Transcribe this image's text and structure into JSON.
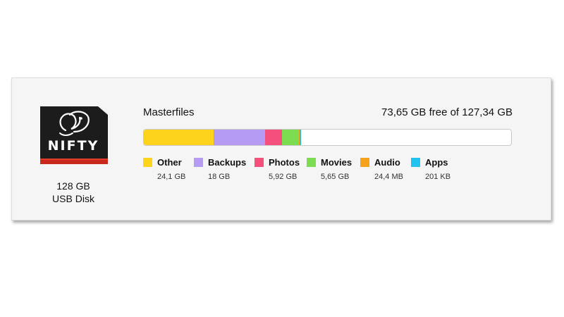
{
  "device": {
    "logo_text": "NIFTY",
    "capacity": "128 GB",
    "type": "USB Disk"
  },
  "volume": {
    "name": "Masterfiles",
    "free_text": "73,65 GB free of 127,34 GB"
  },
  "usage_bar": {
    "total_gb": 127.34,
    "segments": [
      {
        "name": "Other",
        "gb": 24.1,
        "color": "#fdd31b"
      },
      {
        "name": "Backups",
        "gb": 18,
        "color": "#b59bf4"
      },
      {
        "name": "Photos",
        "gb": 5.92,
        "color": "#f54f7d"
      },
      {
        "name": "Movies",
        "gb": 5.65,
        "color": "#7cdc50"
      },
      {
        "name": "Audio",
        "gb": 0.0244,
        "color": "#f6a21c"
      },
      {
        "name": "Apps",
        "gb": 0.201,
        "color": "#20c2ef"
      }
    ]
  },
  "legend": [
    {
      "label": "Other",
      "size": "24,1 GB",
      "color": "#fdd31b"
    },
    {
      "label": "Backups",
      "size": "18 GB",
      "color": "#b59bf4"
    },
    {
      "label": "Photos",
      "size": "5,92 GB",
      "color": "#f54f7d"
    },
    {
      "label": "Movies",
      "size": "5,65 GB",
      "color": "#7cdc50"
    },
    {
      "label": "Audio",
      "size": "24,4 MB",
      "color": "#f6a21c"
    },
    {
      "label": "Apps",
      "size": "201 KB",
      "color": "#20c2ef"
    }
  ]
}
